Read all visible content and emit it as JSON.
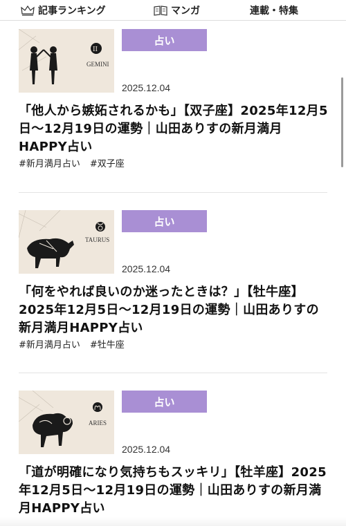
{
  "nav": {
    "ranking": "記事ランキング",
    "manga": "マンガ",
    "series": "連載・特集"
  },
  "articles": [
    {
      "badge": "占い",
      "date": "2025.12.04",
      "title": "「他人から嫉妬されるかも」【双子座】2025年12月5日〜12月19日の運勢｜山田ありすの新月満月HAPPY占い",
      "thumb_label": "GEMINI",
      "hashtags": [
        "#新月満月占い",
        "#双子座"
      ]
    },
    {
      "badge": "占い",
      "date": "2025.12.04",
      "title": "「何をやれば良いのか迷ったときは？」【牡牛座】2025年12月5日〜12月19日の運勢｜山田ありすの新月満月HAPPY占い",
      "thumb_label": "TAURUS",
      "hashtags": [
        "#新月満月占い",
        "#牡牛座"
      ]
    },
    {
      "badge": "占い",
      "date": "2025.12.04",
      "title": "「道が明確になり気持ちもスッキリ」【牡羊座】2025年12月5日〜12月19日の運勢｜山田ありすの新月満月HAPPY占い",
      "thumb_label": "ARIES",
      "hashtags": []
    }
  ],
  "colors": {
    "badge_bg": "#a98fd4",
    "thumb_bg": "#efe7dc"
  }
}
